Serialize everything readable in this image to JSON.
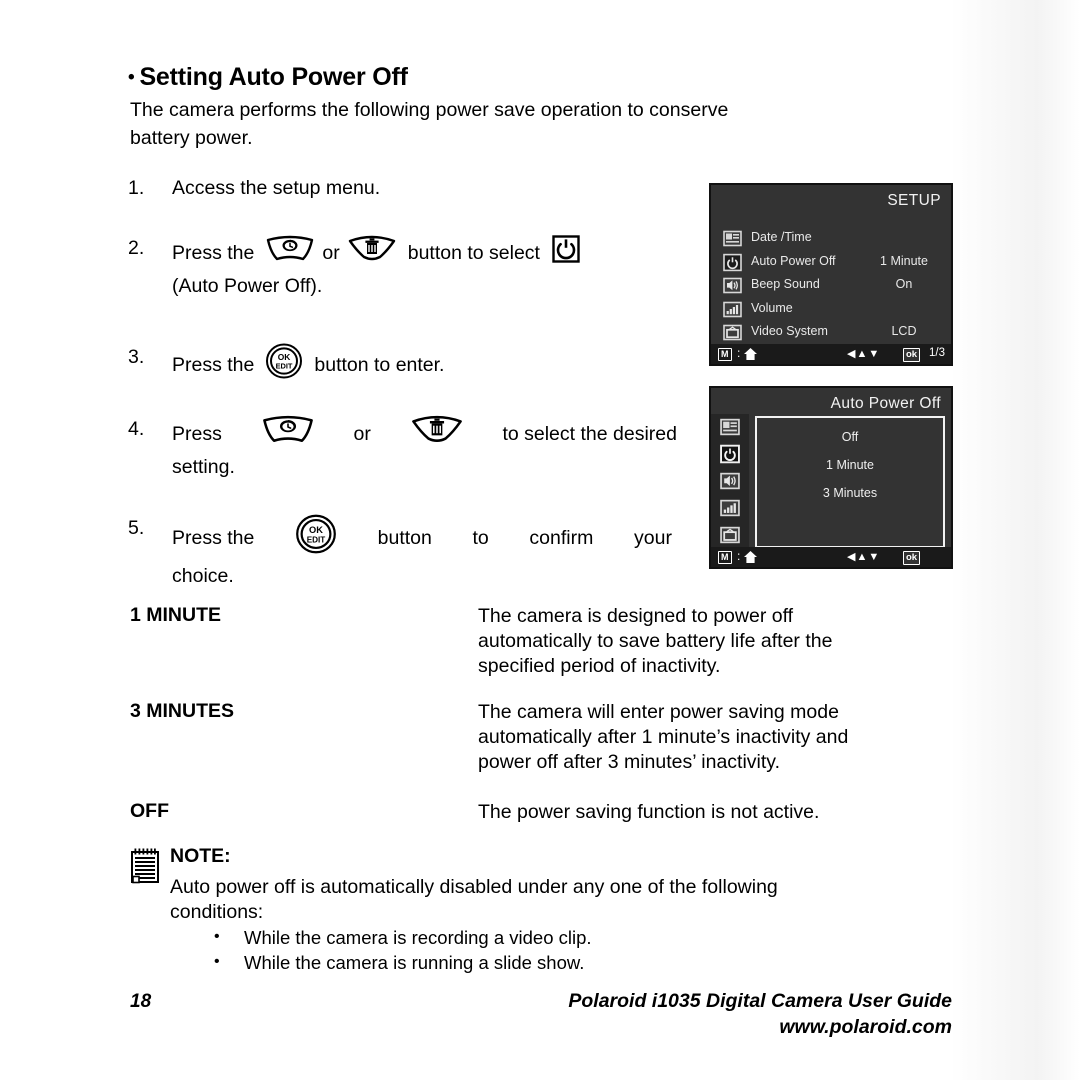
{
  "heading": {
    "bullet": "•",
    "text": "Setting Auto Power Off"
  },
  "intro": {
    "line1": "The camera performs the following power save operation to conserve",
    "line2": "battery power."
  },
  "steps": [
    {
      "num": "1.",
      "text": "Access the setup menu."
    },
    {
      "num": "2.",
      "pre": "Press the",
      "mid": "or",
      "post": "button to select",
      "line2": "(Auto Power Off).",
      "icon_left": "self-timer-button-icon",
      "icon_right": "delete-button-icon",
      "icon_end": "power-symbol-icon"
    },
    {
      "num": "3.",
      "pre": "Press the",
      "post": "button to enter.",
      "icon": "ok-edit-button-icon"
    },
    {
      "num": "4.",
      "pre": "Press",
      "mid": "or",
      "post": "to select the desired",
      "line2": "setting.",
      "icon_left": "self-timer-button-icon",
      "icon_right": "delete-button-icon"
    },
    {
      "num": "5.",
      "pre": "Press the",
      "post_w1": "button",
      "post_w2": "to",
      "post_w3": "confirm",
      "post_w4": "your",
      "line2": "choice.",
      "icon": "ok-edit-button-icon"
    }
  ],
  "button_labels": {
    "ok": "OK",
    "edit": "EDIT"
  },
  "definitions": [
    {
      "term": "1 MINUTE",
      "lines": [
        "The camera is designed to power off",
        "automatically to save battery life after the",
        "specified period of inactivity."
      ]
    },
    {
      "term": "3 MINUTES",
      "lines": [
        "The camera will enter power saving mode",
        "automatically after 1 minute’s inactivity and",
        "power off after 3 minutes’ inactivity."
      ]
    },
    {
      "term": "OFF",
      "lines": [
        "The power saving function is not active."
      ]
    }
  ],
  "note": {
    "icon": "notepad-icon",
    "title": "NOTE:",
    "line1": "Auto power off is automatically disabled under any one of the following",
    "line2": "conditions:",
    "items": [
      "While the camera is recording a video clip.",
      "While the camera is running a slide show."
    ]
  },
  "lcd_setup": {
    "title": "SETUP",
    "rows": [
      {
        "icon": "date-time-icon",
        "label": "Date /Time",
        "value": ""
      },
      {
        "icon": "power-icon",
        "label": "Auto Power Off",
        "value": "1 Minute"
      },
      {
        "icon": "speaker-icon",
        "label": "Beep Sound",
        "value": "On"
      },
      {
        "icon": "volume-bars-icon",
        "label": "Volume",
        "value": ""
      },
      {
        "icon": "tv-monitor-icon",
        "label": "Video System",
        "value": "LCD"
      }
    ],
    "statusbar": {
      "mode_chip": "M",
      "colon": ":",
      "home_icon": "home-icon",
      "arrows": "◀▲▼",
      "ok_chip": "ok",
      "page": "1/3"
    }
  },
  "lcd_auto_power_off": {
    "title": "Auto Power Off",
    "side_icons": [
      "date-time-icon",
      "power-icon",
      "speaker-icon",
      "volume-bars-icon",
      "tv-monitor-icon"
    ],
    "options": [
      "Off",
      "1 Minute",
      "3 Minutes"
    ],
    "statusbar": {
      "mode_chip": "M",
      "colon": ":",
      "home_icon": "home-icon",
      "arrows": "◀▲▼",
      "ok_chip": "ok"
    }
  },
  "footer": {
    "page_number": "18",
    "guide_title": "Polaroid i1035 Digital Camera User Guide",
    "website": "www.polaroid.com"
  }
}
